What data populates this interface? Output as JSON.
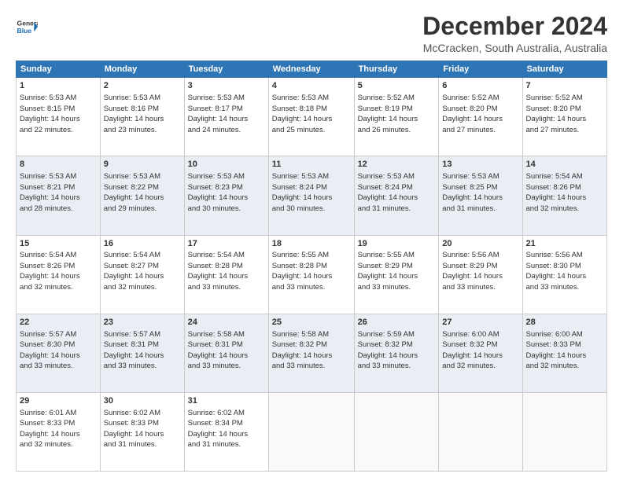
{
  "logo": {
    "line1": "General",
    "line2": "Blue",
    "arrow_color": "#1a6bb5"
  },
  "title": "December 2024",
  "subtitle": "McCracken, South Australia, Australia",
  "weekdays": [
    "Sunday",
    "Monday",
    "Tuesday",
    "Wednesday",
    "Thursday",
    "Friday",
    "Saturday"
  ],
  "weeks": [
    [
      {
        "day": "1",
        "sunrise": "5:53 AM",
        "sunset": "8:15 PM",
        "daylight": "14 hours and 22 minutes."
      },
      {
        "day": "2",
        "sunrise": "5:53 AM",
        "sunset": "8:16 PM",
        "daylight": "14 hours and 23 minutes."
      },
      {
        "day": "3",
        "sunrise": "5:53 AM",
        "sunset": "8:17 PM",
        "daylight": "14 hours and 24 minutes."
      },
      {
        "day": "4",
        "sunrise": "5:53 AM",
        "sunset": "8:18 PM",
        "daylight": "14 hours and 25 minutes."
      },
      {
        "day": "5",
        "sunrise": "5:52 AM",
        "sunset": "8:19 PM",
        "daylight": "14 hours and 26 minutes."
      },
      {
        "day": "6",
        "sunrise": "5:52 AM",
        "sunset": "8:20 PM",
        "daylight": "14 hours and 27 minutes."
      },
      {
        "day": "7",
        "sunrise": "5:52 AM",
        "sunset": "8:20 PM",
        "daylight": "14 hours and 27 minutes."
      }
    ],
    [
      {
        "day": "8",
        "sunrise": "5:53 AM",
        "sunset": "8:21 PM",
        "daylight": "14 hours and 28 minutes."
      },
      {
        "day": "9",
        "sunrise": "5:53 AM",
        "sunset": "8:22 PM",
        "daylight": "14 hours and 29 minutes."
      },
      {
        "day": "10",
        "sunrise": "5:53 AM",
        "sunset": "8:23 PM",
        "daylight": "14 hours and 30 minutes."
      },
      {
        "day": "11",
        "sunrise": "5:53 AM",
        "sunset": "8:24 PM",
        "daylight": "14 hours and 30 minutes."
      },
      {
        "day": "12",
        "sunrise": "5:53 AM",
        "sunset": "8:24 PM",
        "daylight": "14 hours and 31 minutes."
      },
      {
        "day": "13",
        "sunrise": "5:53 AM",
        "sunset": "8:25 PM",
        "daylight": "14 hours and 31 minutes."
      },
      {
        "day": "14",
        "sunrise": "5:54 AM",
        "sunset": "8:26 PM",
        "daylight": "14 hours and 32 minutes."
      }
    ],
    [
      {
        "day": "15",
        "sunrise": "5:54 AM",
        "sunset": "8:26 PM",
        "daylight": "14 hours and 32 minutes."
      },
      {
        "day": "16",
        "sunrise": "5:54 AM",
        "sunset": "8:27 PM",
        "daylight": "14 hours and 32 minutes."
      },
      {
        "day": "17",
        "sunrise": "5:54 AM",
        "sunset": "8:28 PM",
        "daylight": "14 hours and 33 minutes."
      },
      {
        "day": "18",
        "sunrise": "5:55 AM",
        "sunset": "8:28 PM",
        "daylight": "14 hours and 33 minutes."
      },
      {
        "day": "19",
        "sunrise": "5:55 AM",
        "sunset": "8:29 PM",
        "daylight": "14 hours and 33 minutes."
      },
      {
        "day": "20",
        "sunrise": "5:56 AM",
        "sunset": "8:29 PM",
        "daylight": "14 hours and 33 minutes."
      },
      {
        "day": "21",
        "sunrise": "5:56 AM",
        "sunset": "8:30 PM",
        "daylight": "14 hours and 33 minutes."
      }
    ],
    [
      {
        "day": "22",
        "sunrise": "5:57 AM",
        "sunset": "8:30 PM",
        "daylight": "14 hours and 33 minutes."
      },
      {
        "day": "23",
        "sunrise": "5:57 AM",
        "sunset": "8:31 PM",
        "daylight": "14 hours and 33 minutes."
      },
      {
        "day": "24",
        "sunrise": "5:58 AM",
        "sunset": "8:31 PM",
        "daylight": "14 hours and 33 minutes."
      },
      {
        "day": "25",
        "sunrise": "5:58 AM",
        "sunset": "8:32 PM",
        "daylight": "14 hours and 33 minutes."
      },
      {
        "day": "26",
        "sunrise": "5:59 AM",
        "sunset": "8:32 PM",
        "daylight": "14 hours and 33 minutes."
      },
      {
        "day": "27",
        "sunrise": "6:00 AM",
        "sunset": "8:32 PM",
        "daylight": "14 hours and 32 minutes."
      },
      {
        "day": "28",
        "sunrise": "6:00 AM",
        "sunset": "8:33 PM",
        "daylight": "14 hours and 32 minutes."
      }
    ],
    [
      {
        "day": "29",
        "sunrise": "6:01 AM",
        "sunset": "8:33 PM",
        "daylight": "14 hours and 32 minutes."
      },
      {
        "day": "30",
        "sunrise": "6:02 AM",
        "sunset": "8:33 PM",
        "daylight": "14 hours and 31 minutes."
      },
      {
        "day": "31",
        "sunrise": "6:02 AM",
        "sunset": "8:34 PM",
        "daylight": "14 hours and 31 minutes."
      },
      null,
      null,
      null,
      null
    ]
  ],
  "labels": {
    "sunrise": "Sunrise:",
    "sunset": "Sunset:",
    "daylight": "Daylight:"
  }
}
